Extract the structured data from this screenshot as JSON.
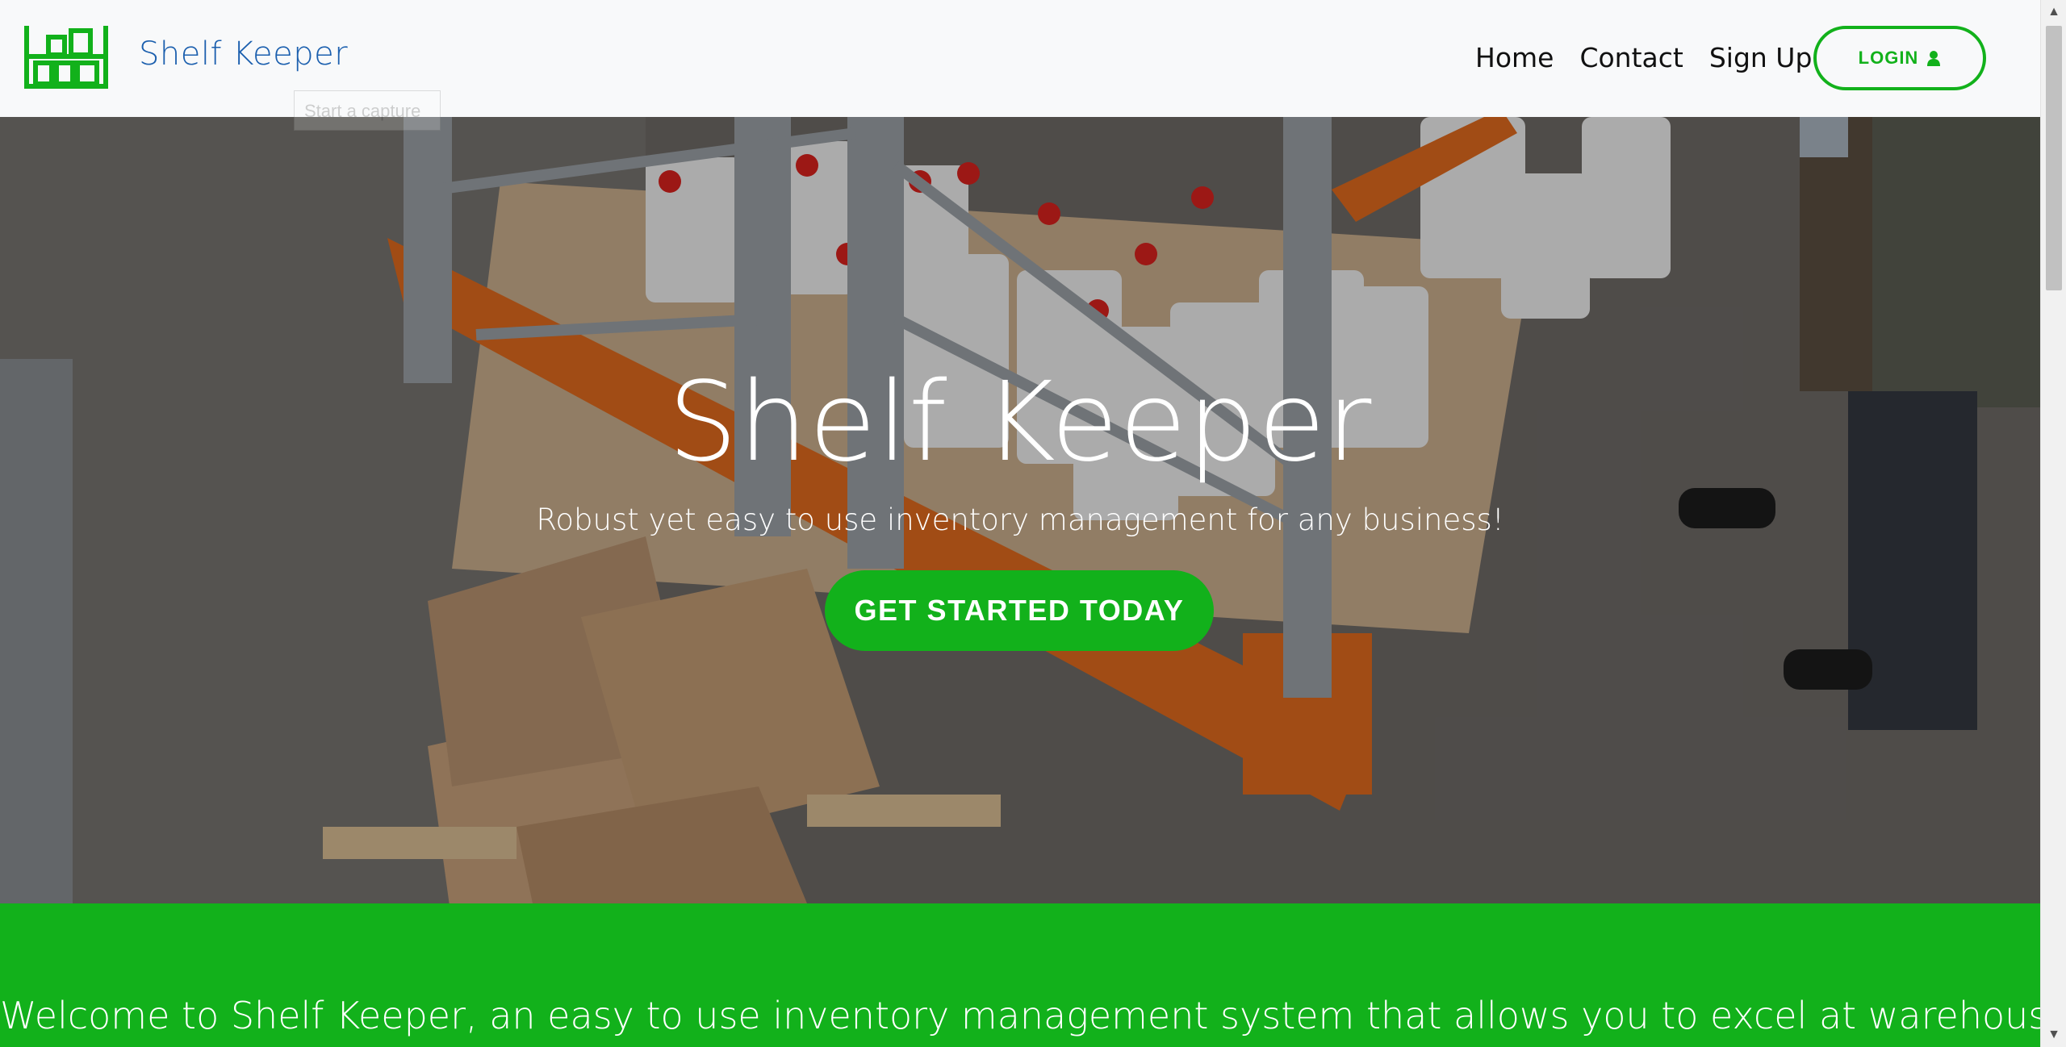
{
  "navbar": {
    "brand_name": "Shelf Keeper",
    "brand_logo_icon": "warehouse-shelf-icon",
    "tooltip": "Start a capture",
    "links": [
      "Home",
      "Contact",
      "Sign Up"
    ],
    "login_label": "LOGIN",
    "login_icon": "user-icon"
  },
  "hero": {
    "title": "Shelf Keeper",
    "subtitle": "Robust yet easy to use inventory management for any business!",
    "cta_label": "GET STARTED TODAY"
  },
  "welcome": {
    "text": "Welcome to Shelf Keeper, an easy to use inventory management system that allows you to excel at warehouse"
  },
  "colors": {
    "accent": "#12b11b",
    "brand_text": "#1b5fae",
    "navbar_bg": "#f8f9fa"
  }
}
